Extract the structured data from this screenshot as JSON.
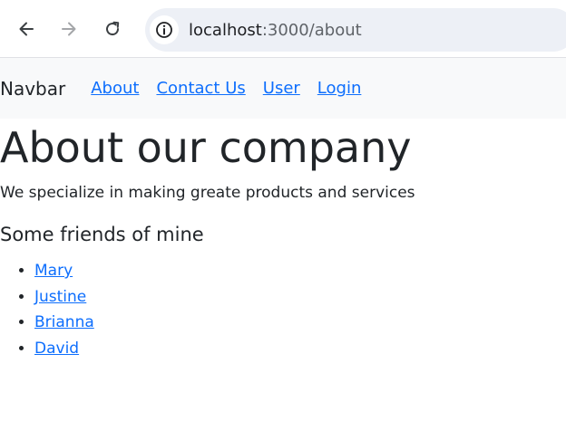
{
  "browser": {
    "url_host": "localhost",
    "url_path": ":3000/about",
    "icons": [
      "back-arrow-icon",
      "forward-arrow-icon",
      "reload-icon",
      "site-info-icon"
    ]
  },
  "navbar": {
    "brand": "Navbar",
    "links": [
      "About",
      "Contact Us",
      "User",
      "Login"
    ]
  },
  "main": {
    "title": "About our company",
    "lead": "We specialize in making greate products and services",
    "friends_heading": "Some friends of mine",
    "friends": [
      "Mary",
      "Justine",
      "Brianna",
      "David"
    ]
  },
  "colors": {
    "link": "#0d6efd",
    "navbar_bg": "#f8f9fa",
    "omnibox_bg": "#edf0f6"
  }
}
